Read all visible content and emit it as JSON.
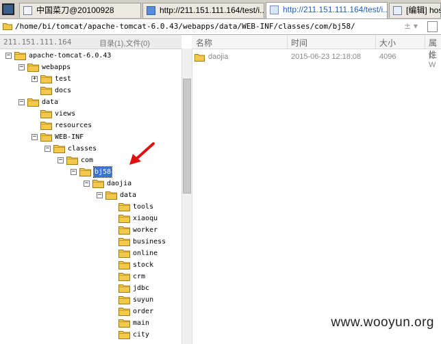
{
  "tabs": [
    {
      "label": "中国菜刀@20100928",
      "icon": "page-icon"
    },
    {
      "label": "http://211.151.111.164/test/i...",
      "icon": "ie-icon"
    },
    {
      "label": "http://211.151.111.164/test/i...",
      "icon": "web-icon",
      "active": true
    },
    {
      "label": "[编辑] host",
      "icon": "edit-icon"
    }
  ],
  "address": {
    "path": "/home/bi/tomcat/apache-tomcat-6.0.43/webapps/data/WEB-INF/classes/com/bj58/",
    "controls": "± ▾"
  },
  "left_panel": {
    "host": "211.151.111.164",
    "summary": "目录(1),文件(0)"
  },
  "tree": [
    {
      "label": "apache-tomcat-6.0.43",
      "expander": "⊟"
    },
    {
      "label": "webapps",
      "expander": "⊟"
    },
    {
      "label": "test",
      "expander": "⊞"
    },
    {
      "label": "docs",
      "expander": ""
    },
    {
      "label": "data",
      "expander": "⊟"
    },
    {
      "label": "views",
      "expander": ""
    },
    {
      "label": "resources",
      "expander": ""
    },
    {
      "label": "WEB-INF",
      "expander": "⊟"
    },
    {
      "label": "classes",
      "expander": "⊟"
    },
    {
      "label": "com",
      "expander": "⊟"
    },
    {
      "label": "bj58",
      "expander": "⊟",
      "selected": true
    },
    {
      "label": "daojia",
      "expander": "⊟"
    },
    {
      "label": "data",
      "expander": "⊟"
    },
    {
      "label": "tools",
      "expander": ""
    },
    {
      "label": "xiaoqu",
      "expander": ""
    },
    {
      "label": "worker",
      "expander": ""
    },
    {
      "label": "business",
      "expander": ""
    },
    {
      "label": "online",
      "expander": ""
    },
    {
      "label": "stock",
      "expander": ""
    },
    {
      "label": "crm",
      "expander": ""
    },
    {
      "label": "jdbc",
      "expander": ""
    },
    {
      "label": "suyun",
      "expander": ""
    },
    {
      "label": "order",
      "expander": ""
    },
    {
      "label": "main",
      "expander": ""
    },
    {
      "label": "city",
      "expander": ""
    }
  ],
  "file_list": {
    "columns": [
      "名称",
      "时间",
      "大小",
      "属性"
    ],
    "rows": [
      {
        "name": "daojia",
        "time": "2015-06-23 12:18:08",
        "size": "4096",
        "attr": "R W"
      }
    ]
  },
  "watermark": "www.wooyun.org",
  "colors": {
    "selection": "#3874d2",
    "arrow": "#e01010",
    "folder": "#f2c94c"
  }
}
